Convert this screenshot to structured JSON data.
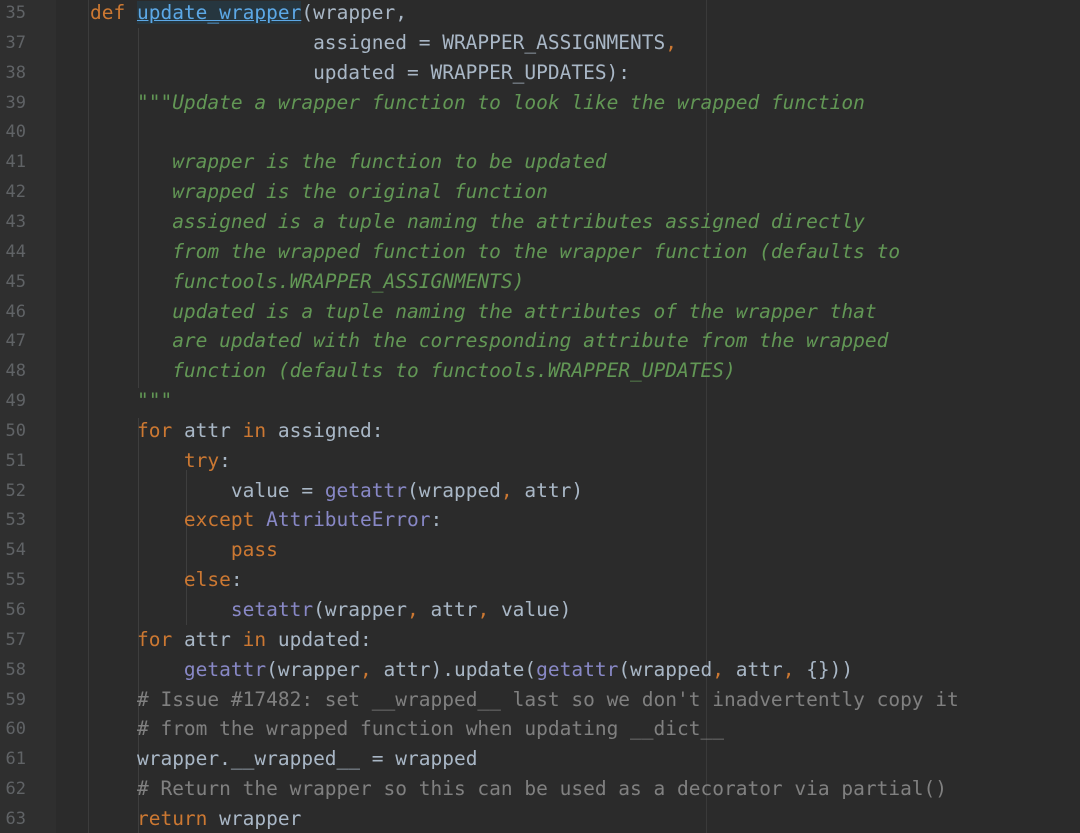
{
  "editor": {
    "lines": [
      {
        "number": "35",
        "indent": "",
        "tokens": [
          {
            "t": "def ",
            "k": "kw"
          },
          {
            "t": "update_wrapper",
            "k": "fnhl"
          },
          {
            "t": "(",
            "k": "p"
          },
          {
            "t": "wrapper,",
            "k": "txt"
          }
        ]
      },
      {
        "number": "37",
        "indent": "                   ",
        "tokens": [
          {
            "t": "assigned = WRAPPER_ASSIGNMENTS",
            "k": "txt"
          },
          {
            "t": ",",
            "k": "kw"
          }
        ]
      },
      {
        "number": "38",
        "indent": "                   ",
        "tokens": [
          {
            "t": "updated = WRAPPER_UPDATES):",
            "k": "txt"
          }
        ]
      },
      {
        "number": "39",
        "indent": "    ",
        "tokens": [
          {
            "t": "\"\"\"Update a wrapper function to look like the wrapped function",
            "k": "doc"
          }
        ]
      },
      {
        "number": "40",
        "indent": "",
        "tokens": []
      },
      {
        "number": "41",
        "indent": "       ",
        "tokens": [
          {
            "t": "wrapper is the function to be updated",
            "k": "doc"
          }
        ]
      },
      {
        "number": "42",
        "indent": "       ",
        "tokens": [
          {
            "t": "wrapped is the original function",
            "k": "doc"
          }
        ]
      },
      {
        "number": "43",
        "indent": "       ",
        "tokens": [
          {
            "t": "assigned is a tuple naming the attributes assigned directly",
            "k": "doc"
          }
        ]
      },
      {
        "number": "44",
        "indent": "       ",
        "tokens": [
          {
            "t": "from the wrapped function to the wrapper function (defaults to",
            "k": "doc"
          }
        ]
      },
      {
        "number": "45",
        "indent": "       ",
        "tokens": [
          {
            "t": "functools.WRAPPER_ASSIGNMENTS)",
            "k": "doc"
          }
        ]
      },
      {
        "number": "46",
        "indent": "       ",
        "tokens": [
          {
            "t": "updated is a tuple naming the attributes of the wrapper that",
            "k": "doc"
          }
        ]
      },
      {
        "number": "47",
        "indent": "       ",
        "tokens": [
          {
            "t": "are updated with the corresponding attribute from the wrapped",
            "k": "doc"
          }
        ]
      },
      {
        "number": "48",
        "indent": "       ",
        "tokens": [
          {
            "t": "function (defaults to functools.WRAPPER_UPDATES)",
            "k": "doc"
          }
        ]
      },
      {
        "number": "49",
        "indent": "    ",
        "tokens": [
          {
            "t": "\"\"\"",
            "k": "doc"
          }
        ]
      },
      {
        "number": "50",
        "indent": "    ",
        "tokens": [
          {
            "t": "for ",
            "k": "kw"
          },
          {
            "t": "attr ",
            "k": "txt"
          },
          {
            "t": "in ",
            "k": "kw"
          },
          {
            "t": "assigned:",
            "k": "txt"
          }
        ]
      },
      {
        "number": "51",
        "indent": "        ",
        "tokens": [
          {
            "t": "try",
            "k": "kw"
          },
          {
            "t": ":",
            "k": "txt"
          }
        ]
      },
      {
        "number": "52",
        "indent": "            ",
        "tokens": [
          {
            "t": "value = ",
            "k": "txt"
          },
          {
            "t": "getattr",
            "k": "bi"
          },
          {
            "t": "(wrapped",
            "k": "txt"
          },
          {
            "t": ", ",
            "k": "kw"
          },
          {
            "t": "attr)",
            "k": "txt"
          }
        ]
      },
      {
        "number": "53",
        "indent": "        ",
        "tokens": [
          {
            "t": "except ",
            "k": "kw"
          },
          {
            "t": "AttributeError",
            "k": "cls"
          },
          {
            "t": ":",
            "k": "txt"
          }
        ]
      },
      {
        "number": "54",
        "indent": "            ",
        "tokens": [
          {
            "t": "pass",
            "k": "kw"
          }
        ]
      },
      {
        "number": "55",
        "indent": "        ",
        "tokens": [
          {
            "t": "else",
            "k": "kw"
          },
          {
            "t": ":",
            "k": "txt"
          }
        ]
      },
      {
        "number": "56",
        "indent": "            ",
        "tokens": [
          {
            "t": "setattr",
            "k": "bi"
          },
          {
            "t": "(wrapper",
            "k": "txt"
          },
          {
            "t": ", ",
            "k": "kw"
          },
          {
            "t": "attr",
            "k": "txt"
          },
          {
            "t": ", ",
            "k": "kw"
          },
          {
            "t": "value)",
            "k": "txt"
          }
        ]
      },
      {
        "number": "57",
        "indent": "    ",
        "tokens": [
          {
            "t": "for ",
            "k": "kw"
          },
          {
            "t": "attr ",
            "k": "txt"
          },
          {
            "t": "in ",
            "k": "kw"
          },
          {
            "t": "updated:",
            "k": "txt"
          }
        ]
      },
      {
        "number": "58",
        "indent": "        ",
        "tokens": [
          {
            "t": "getattr",
            "k": "bi"
          },
          {
            "t": "(wrapper",
            "k": "txt"
          },
          {
            "t": ", ",
            "k": "kw"
          },
          {
            "t": "attr).update(",
            "k": "txt"
          },
          {
            "t": "getattr",
            "k": "bi"
          },
          {
            "t": "(wrapped",
            "k": "txt"
          },
          {
            "t": ", ",
            "k": "kw"
          },
          {
            "t": "attr",
            "k": "txt"
          },
          {
            "t": ", ",
            "k": "kw"
          },
          {
            "t": "{}))",
            "k": "txt"
          }
        ]
      },
      {
        "number": "59",
        "indent": "    ",
        "tokens": [
          {
            "t": "# Issue #17482: set __wrapped__ last so we don't inadvertently copy it",
            "k": "com"
          }
        ]
      },
      {
        "number": "60",
        "indent": "    ",
        "tokens": [
          {
            "t": "# from the wrapped function when updating __dict__",
            "k": "com"
          }
        ]
      },
      {
        "number": "61",
        "indent": "    ",
        "tokens": [
          {
            "t": "wrapper.__wrapped__ = wrapped",
            "k": "txt"
          }
        ]
      },
      {
        "number": "62",
        "indent": "    ",
        "tokens": [
          {
            "t": "# Return the wrapper so this can be used as a decorator via partial()",
            "k": "com"
          }
        ]
      },
      {
        "number": "63",
        "indent": "    ",
        "tokens": [
          {
            "t": "return ",
            "k": "kw"
          },
          {
            "t": "wrapper",
            "k": "txt"
          }
        ]
      }
    ]
  },
  "colors": {
    "background": "#2b2b2b",
    "keyword": "#cc7832",
    "builtin": "#8888c6",
    "docstring": "#629755",
    "comment": "#808080",
    "text": "#a9b7c6",
    "line_number": "#606366"
  }
}
